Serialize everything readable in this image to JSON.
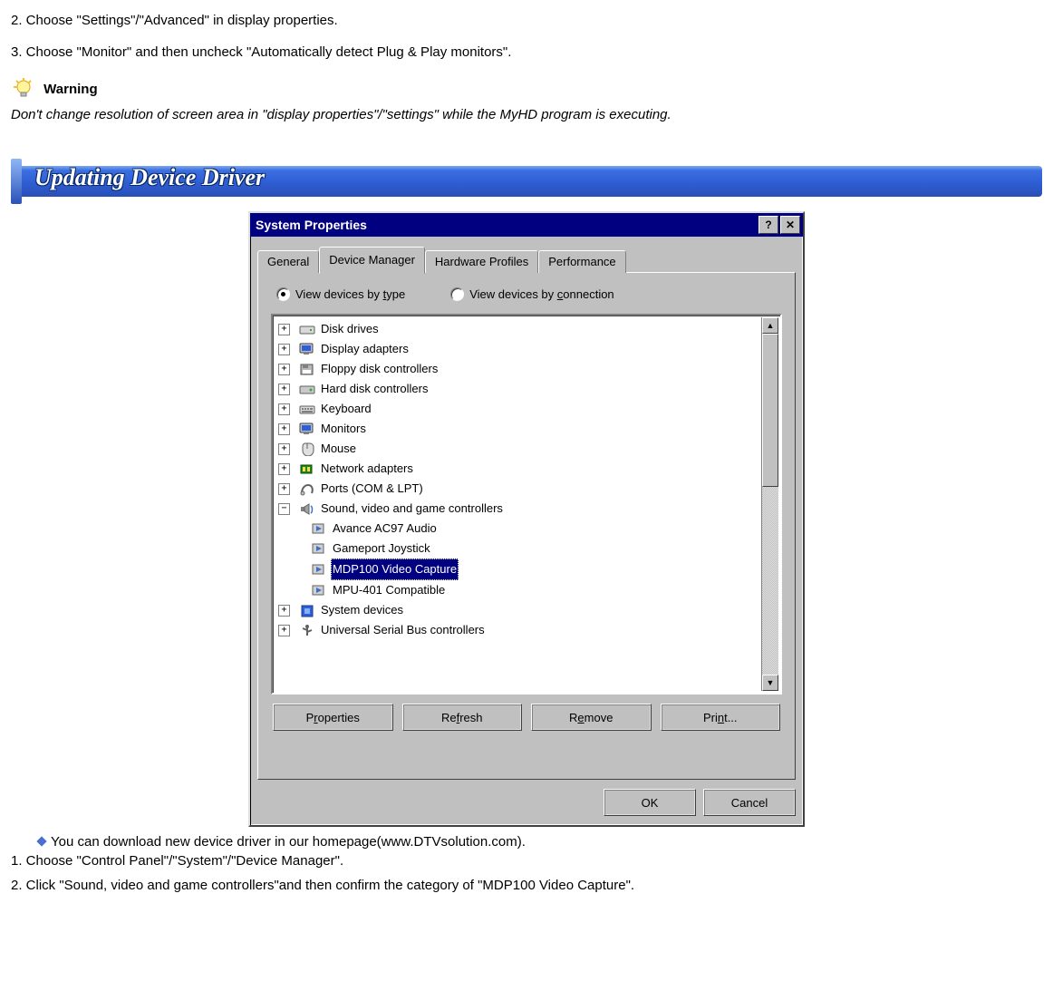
{
  "steps_top": {
    "s2": "2. Choose \"Settings\"/\"Advanced\" in display properties.",
    "s3": "3. Choose \"Monitor\" and then uncheck \"Automatically detect Plug & Play monitors\"."
  },
  "warning": {
    "label": "Warning",
    "text": "Don't change resolution of screen area in \"display properties\"/\"settings\" while the MyHD program is executing."
  },
  "section_title": "Updating Device Driver",
  "dialog": {
    "title": "System Properties",
    "helpbtn": "?",
    "closebtn": "✕",
    "tabs": {
      "general": "General",
      "devmgr": "Device Manager",
      "hwprof": "Hardware Profiles",
      "perf": "Performance"
    },
    "radios": {
      "bytype_pre": "View devices by ",
      "bytype_u": "t",
      "bytype_post": "ype",
      "byconn_pre": "View devices by ",
      "byconn_u": "c",
      "byconn_post": "onnection"
    },
    "tree": {
      "disk": "Disk drives",
      "display": "Display adapters",
      "floppy": "Floppy disk controllers",
      "hdd": "Hard disk controllers",
      "keyboard": "Keyboard",
      "monitors": "Monitors",
      "mouse": "Mouse",
      "network": "Network adapters",
      "ports": "Ports (COM & LPT)",
      "sound": "Sound, video and game controllers",
      "sound_children": {
        "ac97": "Avance AC97 Audio",
        "gameport": "Gameport Joystick",
        "mdp100": "MDP100 Video Capture",
        "mpu401": "MPU-401 Compatible"
      },
      "system": "System devices",
      "usb": "Universal Serial Bus controllers"
    },
    "buttons": {
      "props_pre": "P",
      "props_u": "r",
      "props_post": "operties",
      "refresh_pre": "Re",
      "refresh_u": "f",
      "refresh_post": "resh",
      "remove_pre": "R",
      "remove_u": "e",
      "remove_post": "move",
      "print_pre": "Pri",
      "print_u": "n",
      "print_post": "t..."
    },
    "footer": {
      "ok": "OK",
      "cancel": "Cancel"
    }
  },
  "note": "You can download new device driver in  our homepage(www.DTVsolution.com).",
  "steps_bottom": {
    "s1": "1. Choose \"Control Panel\"/\"System\"/\"Device Manager\".",
    "s2": "2. Click \"Sound, video and game controllers\"and then confirm the  category of \"MDP100 Video Capture\"."
  }
}
